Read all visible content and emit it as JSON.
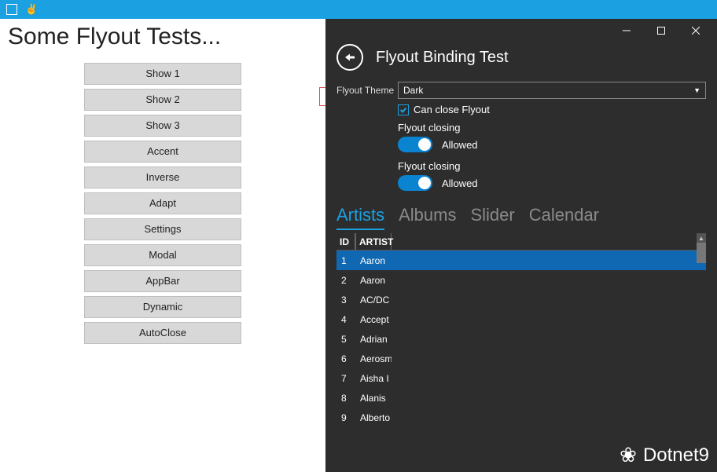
{
  "titlebar": {
    "title_icon": "cube",
    "peace_icon": "✌"
  },
  "left": {
    "heading": "Some Flyout Tests...",
    "buttons": [
      "Show 1",
      "Show 2",
      "Show 3",
      "Accent",
      "Inverse",
      "Adapt",
      "Settings",
      "Modal",
      "AppBar",
      "Dynamic",
      "AutoClose"
    ]
  },
  "flyout": {
    "title": "Flyout Binding Test",
    "theme_label": "Flyout Theme",
    "theme_value": "Dark",
    "can_close_label": "Can close Flyout",
    "can_close_checked": true,
    "closing1_label": "Flyout closing",
    "closing1_state": "Allowed",
    "closing2_label": "Flyout closing",
    "closing2_state": "Allowed",
    "tabs": [
      "Artists",
      "Albums",
      "Slider",
      "Calendar"
    ],
    "active_tab": 0,
    "columns": {
      "id": "ID",
      "artist": "ARTIST"
    },
    "rows": [
      {
        "id": "1",
        "artist": "Aaron"
      },
      {
        "id": "2",
        "artist": "Aaron"
      },
      {
        "id": "3",
        "artist": "AC/DC"
      },
      {
        "id": "4",
        "artist": "Accept"
      },
      {
        "id": "5",
        "artist": "Adrian"
      },
      {
        "id": "6",
        "artist": "Aerosm"
      },
      {
        "id": "7",
        "artist": "Aisha I"
      },
      {
        "id": "8",
        "artist": "Alanis"
      },
      {
        "id": "9",
        "artist": "Alberto"
      }
    ],
    "selected_row": 0,
    "watermark": "Dotnet9"
  }
}
